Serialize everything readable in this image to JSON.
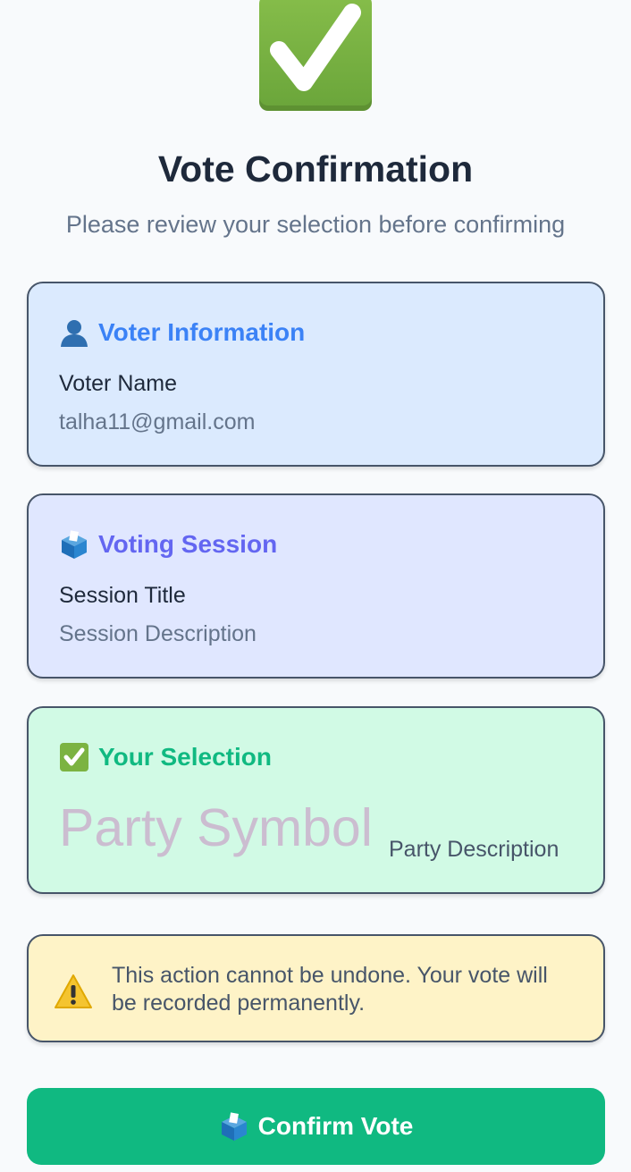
{
  "header": {
    "icon": "check-mark-box-icon",
    "title": "Vote Confirmation",
    "subtitle": "Please review your selection before confirming"
  },
  "voter_card": {
    "icon": "person-silhouette-icon",
    "heading": "Voter Information",
    "name": "Voter Name",
    "email": "talha11@gmail.com",
    "accent_color": "#3b82f6",
    "background": "#dbeafe"
  },
  "session_card": {
    "icon": "ballot-box-icon",
    "heading": "Voting Session",
    "title": "Session Title",
    "description": "Session Description",
    "accent_color": "#6366f1",
    "background": "#e0e7ff"
  },
  "selection_card": {
    "icon": "check-mark-box-icon",
    "heading": "Your Selection",
    "party_symbol": "Party Symbol",
    "party_description": "Party Description",
    "accent_color": "#10b981",
    "background": "#d1fae5"
  },
  "warning_card": {
    "icon": "warning-icon",
    "text": "This action cannot be undone. Your vote will be recorded permanently.",
    "background": "#fef3c7"
  },
  "confirm_button": {
    "icon": "ballot-box-icon",
    "label": "Confirm Vote",
    "color": "#10b981"
  }
}
